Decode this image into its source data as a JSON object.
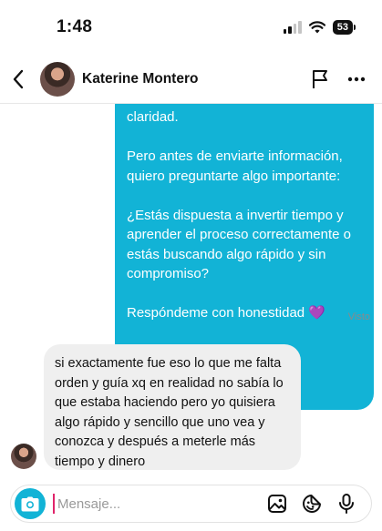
{
  "status_bar": {
    "time": "1:48",
    "battery": "53"
  },
  "header": {
    "contact_name": "Katerine Montero"
  },
  "messages": {
    "outgoing": [
      "claridad.",
      "Pero antes de enviarte información, quiero preguntarte algo importante:",
      "¿Estás dispuesta a invertir tiempo y aprender el proceso correctamente o estás buscando algo rápido y sin compromiso?",
      "Respóndeme con honestidad 💜"
    ],
    "seen_label": "Visto",
    "incoming": "si exactamente fue eso lo que me falta orden  y guía xq en realidad no sabía lo que estaba haciendo  pero yo quisiera algo rápido y sencillo que uno vea y conozca y después  a meterle más tiempo y dinero"
  },
  "composer": {
    "placeholder": "Mensaje..."
  },
  "colors": {
    "accent": "#12b3d6",
    "incoming_bubble": "#efefef",
    "cursor": "#e0246a"
  }
}
